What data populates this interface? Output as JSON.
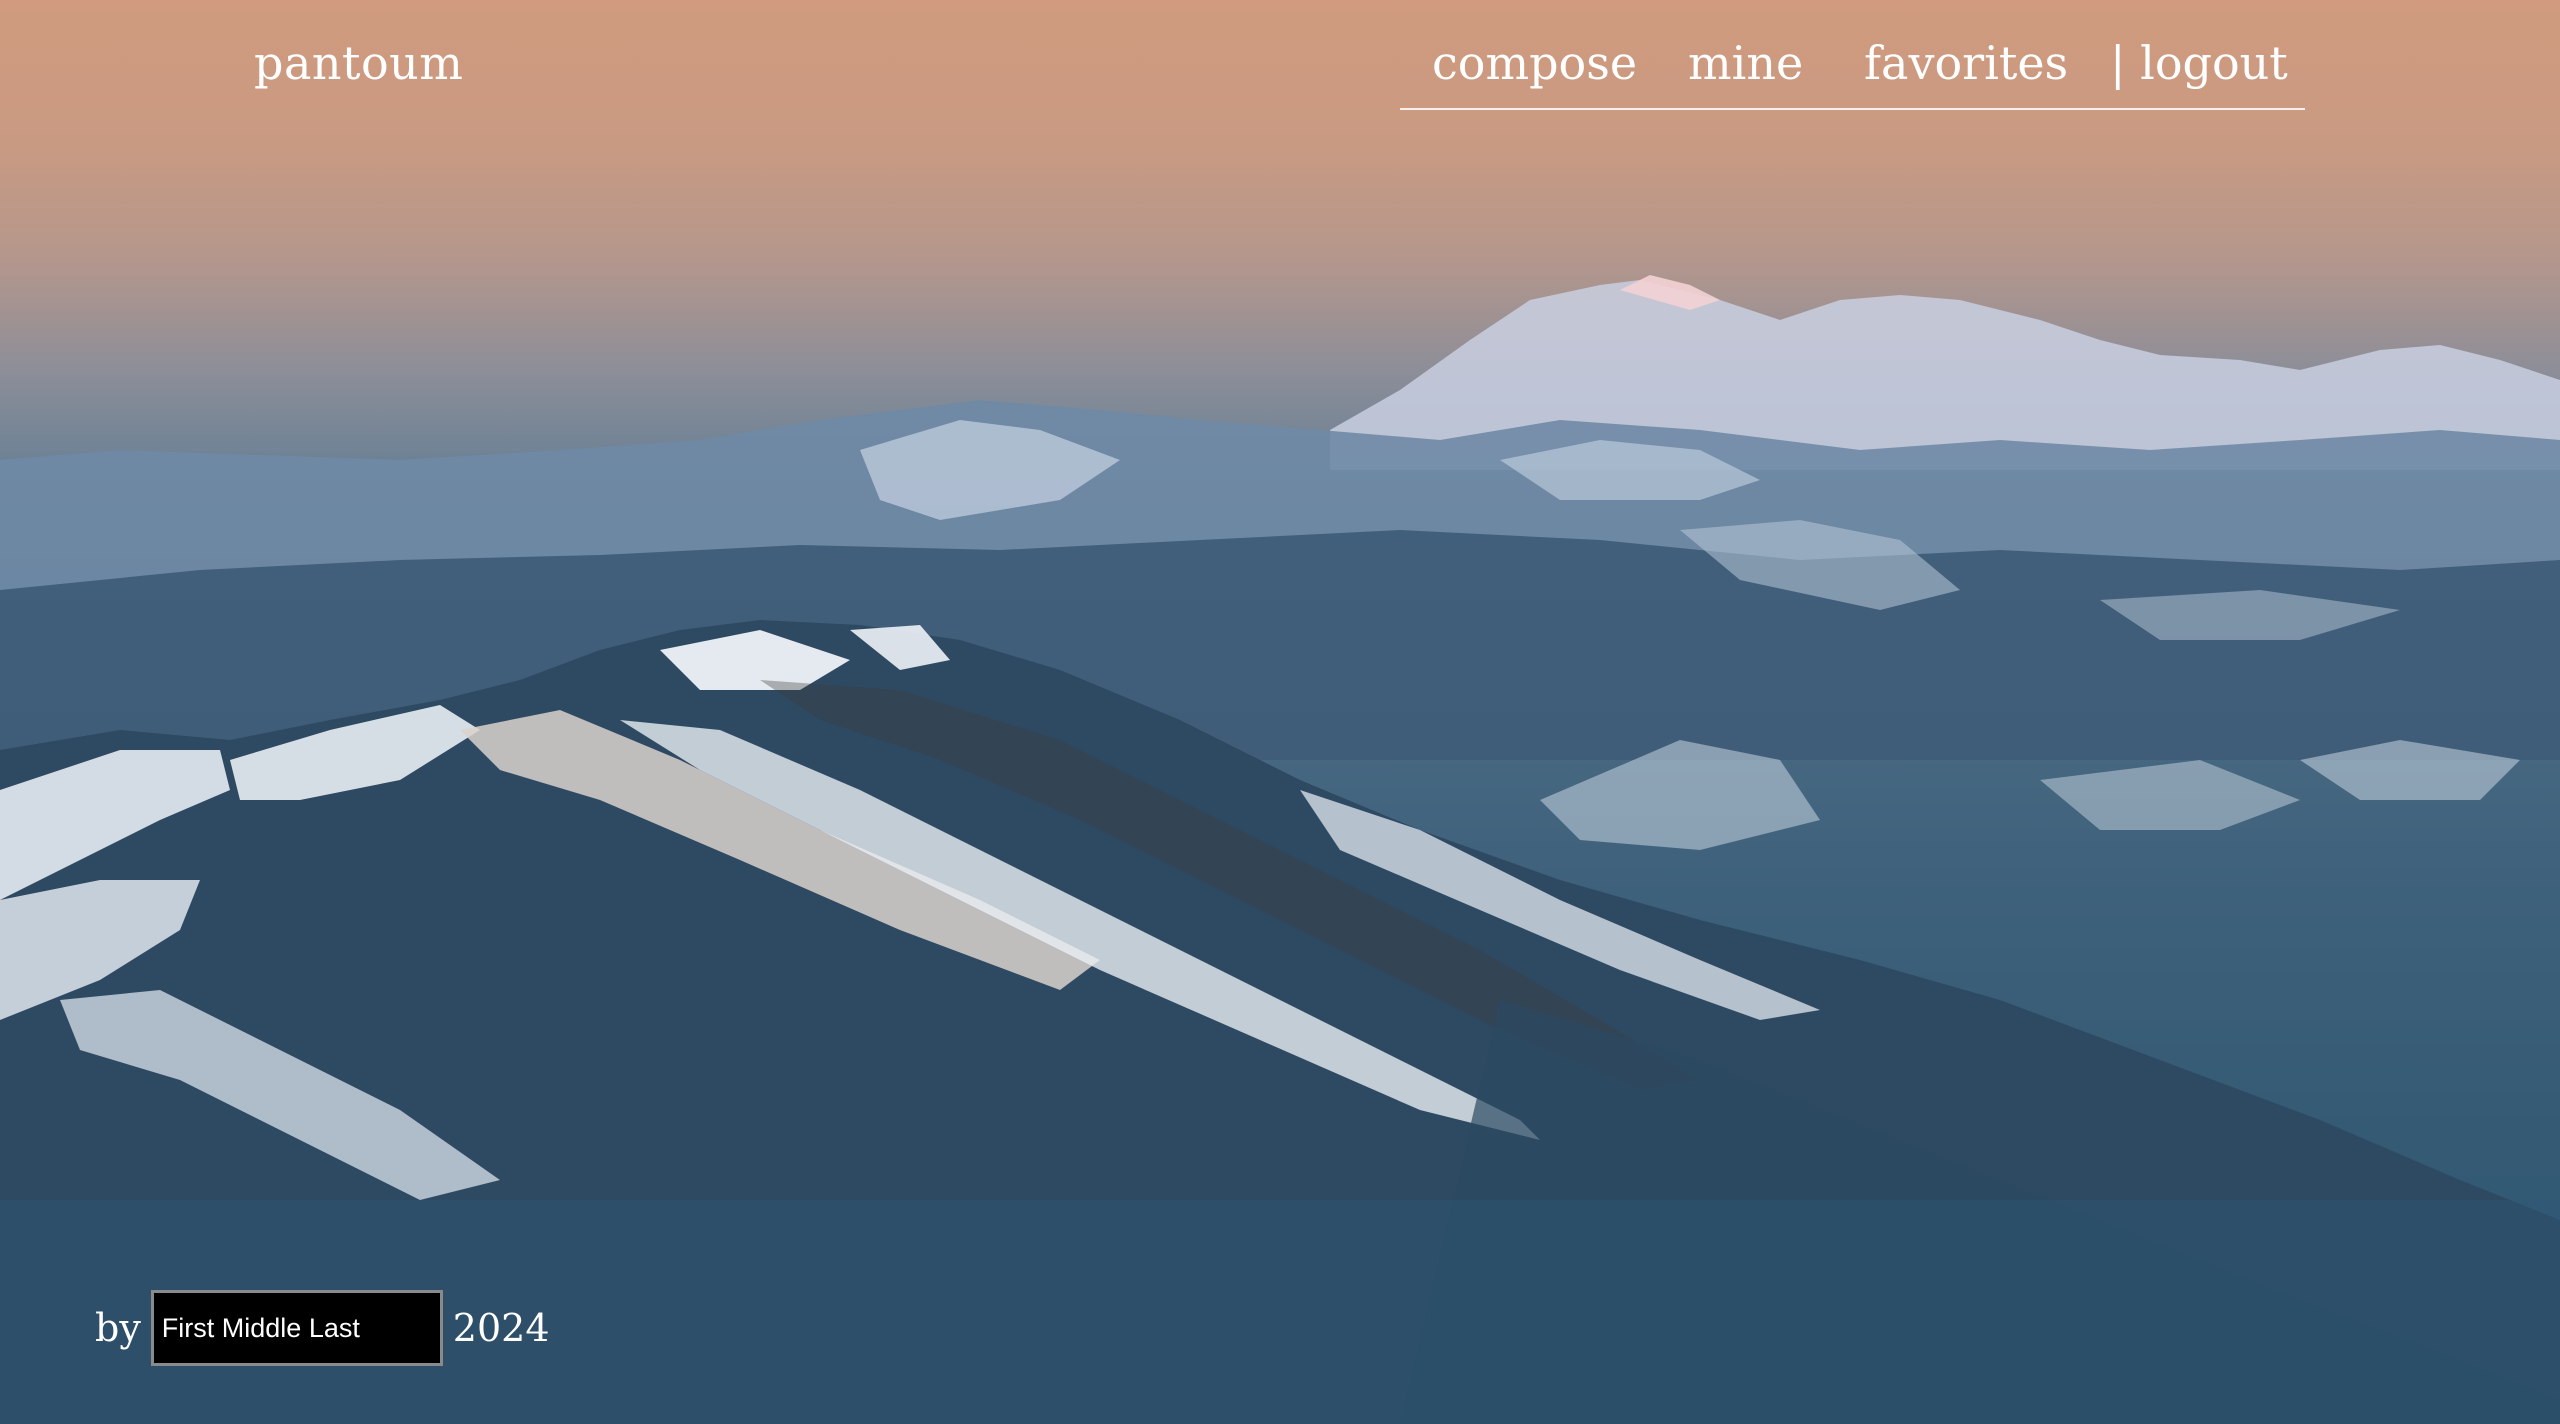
{
  "header": {
    "brand": "pantoum",
    "nav": {
      "compose": "compose",
      "mine": "mine",
      "favorites": "favorites",
      "logout": "| logout"
    }
  },
  "byline": {
    "prefix": "by",
    "author_placeholder": "First Middle Last",
    "year": "2024"
  },
  "background": {
    "sky_color": "#d09b7e",
    "mountain_color": "#2f5a78",
    "snow_color": "#dfe6ee"
  }
}
